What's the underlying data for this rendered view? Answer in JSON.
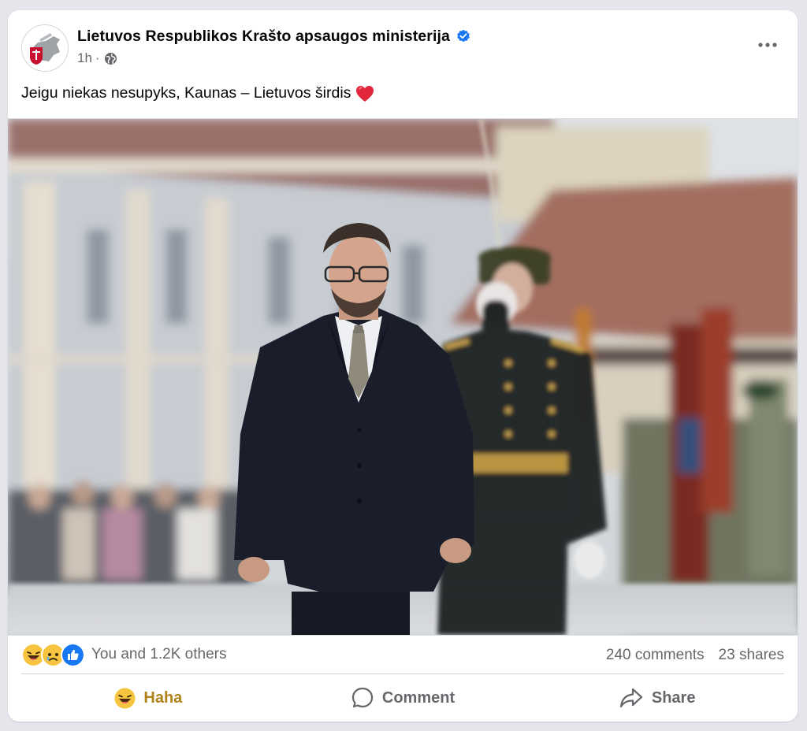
{
  "post": {
    "page_name": "Lietuvos Respublikos Krašto apsaugos ministerija",
    "verified_icon": "verified-badge-icon",
    "time": "1h",
    "separator": "·",
    "audience_icon": "globe-icon",
    "more_icon": "more-horizontal-icon",
    "caption": "Jeigu niekas nesupyks, Kaunas – Lietuvos širdis",
    "caption_emoji": "red-heart"
  },
  "reactions": {
    "icons": [
      "haha",
      "sad",
      "like"
    ],
    "summary": "You and 1.2K others",
    "comments": "240 comments",
    "shares": "23 shares"
  },
  "actions": {
    "react_label": "Haha",
    "comment_label": "Comment",
    "share_label": "Share"
  },
  "colors": {
    "verified_blue": "#1877f2",
    "secondary_text": "#65676b",
    "haha_active": "#b0821a"
  }
}
